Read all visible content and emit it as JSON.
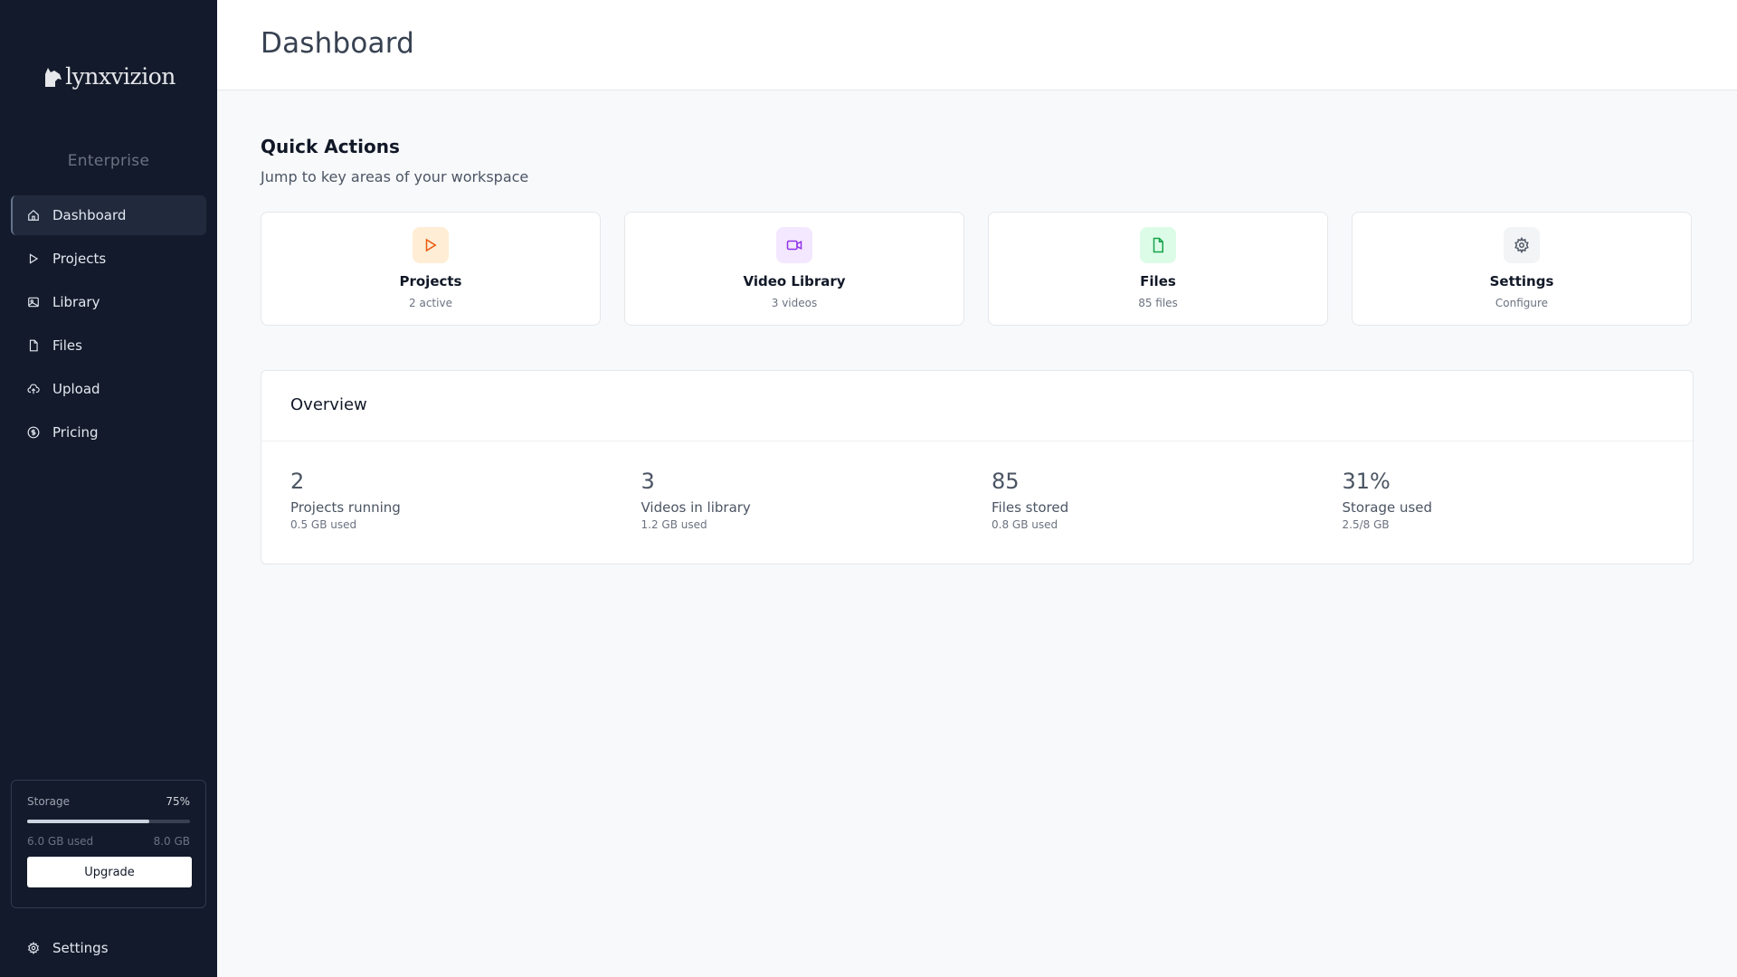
{
  "app": {
    "logo_text": "lynxvizion",
    "tier": "Enterprise"
  },
  "sidebar": {
    "items": [
      {
        "label": "Dashboard",
        "icon": "home-icon",
        "active": true
      },
      {
        "label": "Projects",
        "icon": "play-icon"
      },
      {
        "label": "Library",
        "icon": "image-icon"
      },
      {
        "label": "Files",
        "icon": "file-icon"
      },
      {
        "label": "Upload",
        "icon": "cloud-upload-icon"
      },
      {
        "label": "Pricing",
        "icon": "dollar-circle-icon"
      }
    ],
    "storage": {
      "label": "Storage",
      "percent_text": "75%",
      "fill_fraction": 0.75,
      "used": "6.0 GB used",
      "total": "8.0 GB",
      "upgrade_label": "Upgrade"
    },
    "settings_label": "Settings"
  },
  "header": {
    "title": "Dashboard"
  },
  "quick_actions": {
    "title": "Quick Actions",
    "subtitle": "Jump to key areas of your workspace",
    "cards": [
      {
        "title": "Projects",
        "sub": "2 active",
        "icon": "play-icon",
        "color": "#ea580c",
        "bg": "#ffedd5"
      },
      {
        "title": "Video Library",
        "sub": "3 videos",
        "icon": "video-icon",
        "color": "#9333ea",
        "bg": "#f3e8ff"
      },
      {
        "title": "Files",
        "sub": "85 files",
        "icon": "file-icon",
        "color": "#16a34a",
        "bg": "#dcfce7"
      },
      {
        "title": "Settings",
        "sub": "Configure",
        "icon": "gear-icon",
        "color": "#4b5563",
        "bg": "#f3f4f6"
      }
    ]
  },
  "overview": {
    "title": "Overview",
    "stats": [
      {
        "value": "2",
        "label": "Projects running",
        "sub": "0.5 GB used"
      },
      {
        "value": "3",
        "label": "Videos in library",
        "sub": "1.2 GB used"
      },
      {
        "value": "85",
        "label": "Files stored",
        "sub": "0.8 GB used"
      },
      {
        "value": "31%",
        "label": "Storage used",
        "sub": "2.5/8 GB"
      }
    ]
  }
}
